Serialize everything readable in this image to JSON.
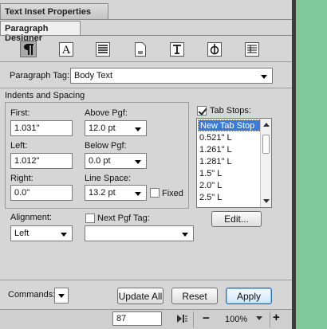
{
  "window": {
    "title": "Text Inset Properties"
  },
  "tab": {
    "label": "Paragraph Designer"
  },
  "toolbar": {
    "icons": [
      "paragraph-icon",
      "font-icon",
      "justify-icon",
      "page-icon",
      "text-frame-icon",
      "asian-icon",
      "table-cell-icon"
    ]
  },
  "paragraph_tag": {
    "label": "Paragraph Tag:",
    "value": "Body Text"
  },
  "indents": {
    "heading": "Indents and Spacing",
    "first_label": "First:",
    "first_value": "1.031\"",
    "left_label": "Left:",
    "left_value": "1.012\"",
    "right_label": "Right:",
    "right_value": "0.0\"",
    "above_label": "Above Pgf:",
    "above_value": "12.0 pt",
    "below_label": "Below Pgf:",
    "below_value": "0.0 pt",
    "linespace_label": "Line Space:",
    "linespace_value": "13.2 pt",
    "fixed_label": "Fixed"
  },
  "tabstops": {
    "label": "Tab Stops:",
    "items": [
      "New Tab Stop",
      "0.521\"  L",
      "1.261\"  L",
      "1.281\"  L",
      "1.5\"  L",
      "2.0\"  L",
      "2.5\"  L"
    ],
    "edit_label": "Edit..."
  },
  "alignment": {
    "label": "Alignment:",
    "value": "Left"
  },
  "next_pgf": {
    "label": "Next Pgf Tag:",
    "value": ""
  },
  "commands": {
    "label": "Commands:"
  },
  "buttons": {
    "update_all": "Update All",
    "reset": "Reset",
    "apply": "Apply"
  },
  "status": {
    "page": "87",
    "zoom": "100%"
  },
  "colors": {
    "accent": "#3a7bd5",
    "background": "#7fc89a"
  }
}
